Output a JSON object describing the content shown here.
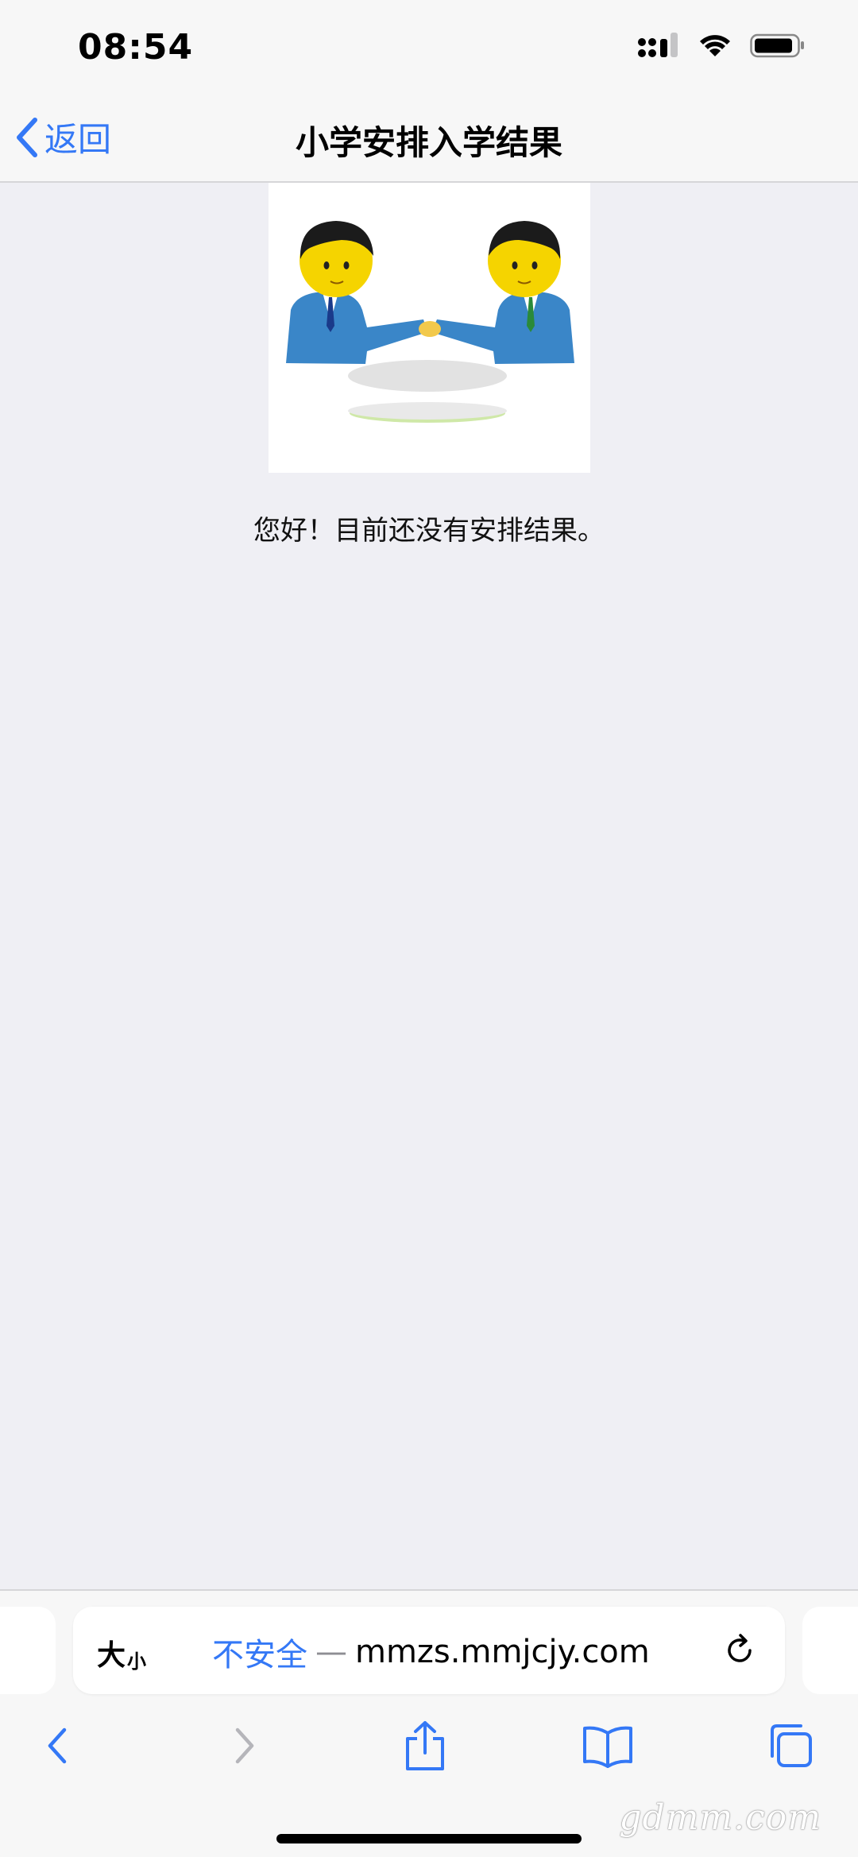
{
  "status_bar": {
    "time": "08:54"
  },
  "nav": {
    "back_label": "返回",
    "title": "小学安排入学结果"
  },
  "content": {
    "message": "您好！目前还没有安排结果。"
  },
  "browser": {
    "text_size_big": "大",
    "text_size_small": "小",
    "url_security": "不安全",
    "url_dash": "—",
    "url_domain": "mmzs.mmjcjy.com"
  },
  "watermark": "gdmm.com",
  "colors": {
    "accent": "#3478f6",
    "background": "#efeff4",
    "bar": "#f7f7f7"
  }
}
